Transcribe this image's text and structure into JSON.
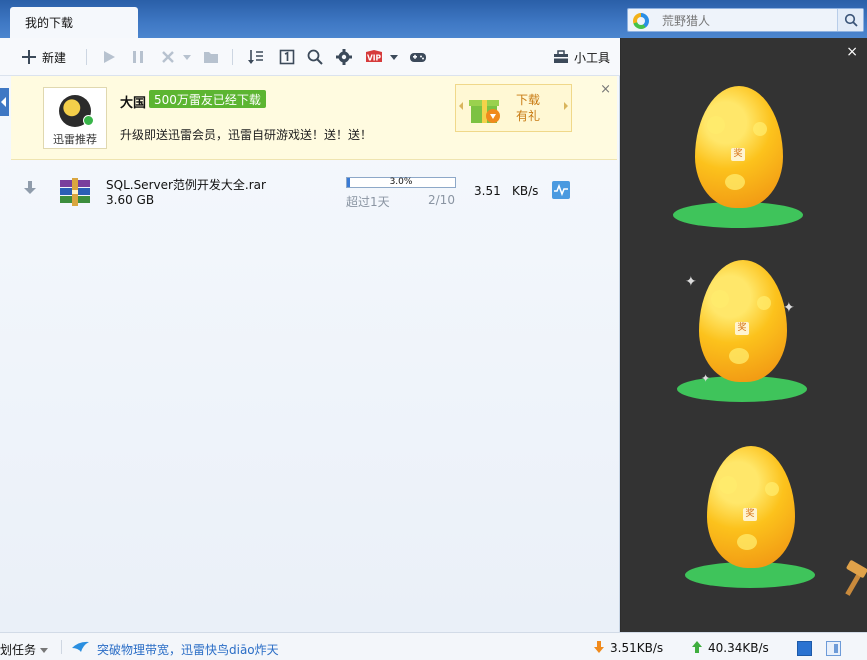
{
  "header": {
    "active_tab": "我的下载",
    "search_placeholder": "荒野猎人"
  },
  "toolbar": {
    "new_label": "新建",
    "tools_label": "小工具"
  },
  "promo": {
    "avatar_label": "迅雷推荐",
    "title": "大国",
    "badge": "500万雷友已经下载",
    "desc": "升级即送迅雷会员，迅雷自研游戏送！送！送！",
    "gift_line1": "下载",
    "gift_line2": "有礼",
    "close": "×"
  },
  "download": {
    "name": "SQL.Server范例开发大全.rar",
    "size": "3.60 GB",
    "progress_text": "3.0%",
    "progress": 0.03,
    "eta": "超过1天",
    "connections": "2/10",
    "speed": "3.51",
    "speed_unit": "KB/s"
  },
  "ad": {
    "close": "×",
    "egg_tag": "奖"
  },
  "status": {
    "plan": "划任务",
    "news": "突破物理带宽，迅雷快鸟diāo炸天",
    "down_speed": "3.51KB/s",
    "up_speed": "40.34KB/s"
  },
  "colors": {
    "header_blue": "#3f78c4",
    "progress_blue": "#3a7bd5",
    "badge_green": "#5cb531",
    "news_blue": "#2a6dc6"
  }
}
